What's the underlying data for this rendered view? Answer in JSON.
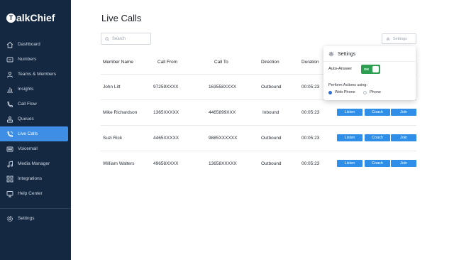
{
  "app": {
    "logo_text": "alkChief",
    "logo_letter": "T"
  },
  "sidebar": {
    "items": [
      {
        "label": "Dashboard",
        "icon": "home-icon"
      },
      {
        "label": "Numbers",
        "icon": "phone-numbers-icon"
      },
      {
        "label": "Teams & Members",
        "icon": "team-icon"
      },
      {
        "label": "Insights",
        "icon": "bar-chart-icon"
      },
      {
        "label": "Call Flow",
        "icon": "call-flow-icon"
      },
      {
        "label": "Queues",
        "icon": "queue-icon"
      },
      {
        "label": "Live Calls",
        "icon": "phone-icon",
        "active": true
      },
      {
        "label": "Voicemail",
        "icon": "voicemail-icon"
      },
      {
        "label": "Media Manager",
        "icon": "music-icon"
      },
      {
        "label": "Integrations",
        "icon": "integrations-icon"
      },
      {
        "label": "Help Center",
        "icon": "help-icon"
      }
    ],
    "settings_label": "Settings"
  },
  "page": {
    "title": "Live Calls",
    "search_placeholder": "Search",
    "settings_button": "Settings"
  },
  "table": {
    "columns": [
      "Member Name",
      "Call From",
      "Call To",
      "Direction",
      "Duration"
    ],
    "rows": [
      {
        "member": "John Litt",
        "from": "97259XXXX",
        "to": "163558XXXX",
        "direction": "Outbound",
        "duration": "00:05:23"
      },
      {
        "member": "Mike Richardson",
        "from": "1365XXXXX",
        "to": "4465899XXX",
        "direction": "Inbound",
        "duration": "00:05:23"
      },
      {
        "member": "Suzi Rick",
        "from": "4465XXXXX",
        "to": "9885XXXXXX",
        "direction": "Outbound",
        "duration": "00:05:23"
      },
      {
        "member": "William Walters",
        "from": "49658XXXX",
        "to": "13658XXXXX",
        "direction": "Outbound",
        "duration": "00:05:23"
      }
    ],
    "actions": {
      "listen": "Listen",
      "coach": "Coach",
      "join": "Join"
    }
  },
  "settings_popover": {
    "title": "Settings",
    "auto_answer_label": "Auto-Answer",
    "auto_answer_toggle": "ON",
    "perform_actions_label": "Perform Actions using:",
    "options": [
      "Web Phone",
      "Phone"
    ],
    "selected_option": "Web Phone"
  },
  "colors": {
    "sidebar_bg": "#142841",
    "accent": "#3e8ee6",
    "action_button": "#2f8fe8",
    "toggle_on": "#2e9e52"
  }
}
